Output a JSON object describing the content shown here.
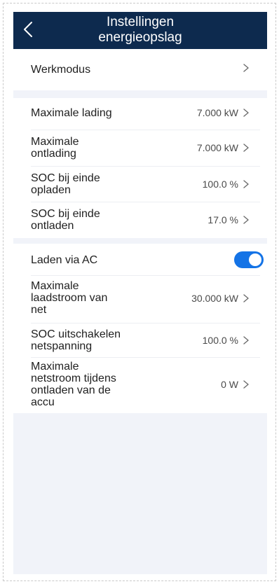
{
  "header": {
    "title_line1": "Instellingen",
    "title_line2": "energieopslag",
    "back_icon": "chevron-left-icon",
    "background": "#0d2a4e"
  },
  "rows": {
    "werkmodus": {
      "label": "Werkmodus",
      "value": ""
    },
    "maximale_lading": {
      "label": "Maximale lading",
      "value": "7.000 kW"
    },
    "maximale_ontlading": {
      "label_line1": "Maximale",
      "label_line2": "ontlading",
      "value": "7.000 kW"
    },
    "soc_einde_opladen": {
      "label_line1": "SOC bij einde",
      "label_line2": "opladen",
      "value": "100.0 %"
    },
    "soc_einde_ontladen": {
      "label_line1": "SOC bij einde",
      "label_line2": "ontladen",
      "value": "17.0 %"
    },
    "laden_via_ac": {
      "label": "Laden via AC",
      "toggle_on": true
    },
    "maximale_laadstroom": {
      "label_line1": "Maximale",
      "label_line2": "laadstroom van",
      "label_line3": "net",
      "value": "30.000 kW"
    },
    "soc_uitschakelen": {
      "label_line1": "SOC uitschakelen",
      "label_line2": "netspanning",
      "value": "100.0 %"
    },
    "maximale_netstroom": {
      "label_line1": "Maximale",
      "label_line2": "netstroom tijdens",
      "label_line3": "ontladen van de",
      "label_line4": "accu",
      "value": "0 W"
    }
  },
  "colors": {
    "accent": "#1473e6",
    "page_background": "#f1f3f9"
  }
}
